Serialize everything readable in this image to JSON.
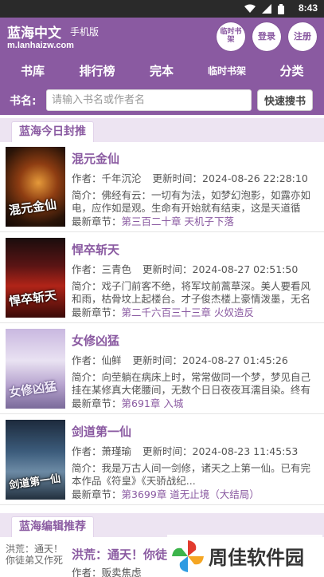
{
  "status_bar": {
    "time": "8:43",
    "icons": [
      "wifi-icon",
      "signal-icon",
      "battery-icon"
    ]
  },
  "header": {
    "site_name": "蓝海中文",
    "site_sub": "手机版",
    "site_url": "m.lanhaizw.com",
    "buttons": {
      "bookshelf": "临时书架",
      "login": "登录",
      "register": "注册"
    }
  },
  "nav": {
    "items": [
      "书库",
      "排行榜",
      "完本",
      "临时书架",
      "分类"
    ]
  },
  "search": {
    "label": "书名:",
    "placeholder": "请输入书名或作者名",
    "button": "快速搜书"
  },
  "sections": {
    "recommend": "蓝海今日封推",
    "editor": "蓝海编辑推荐"
  },
  "labels": {
    "author": "作者：",
    "updated": "更新时间：",
    "intro": "简介：",
    "latest": "最新章节："
  },
  "books": [
    {
      "title": "混元金仙",
      "author": "千年沉沦",
      "updated": "2024-08-26 22:28:10",
      "intro_1": "佛经有云：一切有为法，如梦幻泡影，如露亦如",
      "intro_2": "电，应作如是观。生命有开始就有结束，这是天道循",
      "latest": "第三百二十章 天机子下落",
      "cover_text": "混元金仙"
    },
    {
      "title": "悍卒斩天",
      "author": "三青色",
      "updated": "2024-08-27 02:51:50",
      "intro_1": "戏子门前客不绝，将军坟前蒿草深。美人要看风",
      "intro_2": "和雨，枯骨坟上起楼台。才子俊杰楼上豪情泼墨，无名",
      "latest": "第二千六百三十三章 火奴造反",
      "cover_text": "悍卒斩天"
    },
    {
      "title": "女修凶猛",
      "author": "仙鲜",
      "updated": "2024-08-27 01:45:26",
      "intro_1": "向茔躺在病床上时，常常做同一个梦，梦见自己",
      "intro_2": "挂在某修真大佬腰间，无数个日日夜夜耳濡目染。终有",
      "latest": "第691章 入城",
      "cover_text": "女修凶猛"
    },
    {
      "title": "剑道第一仙",
      "author": "萧瑾瑜",
      "updated": "2024-08-23 11:45:53",
      "intro_1": "我是万古人间一剑修，诸天之上第一仙。已有完",
      "intro_2": "本作品《符皇》《天骄战纪...",
      "latest": "第3699章 道无止境（大结局）",
      "cover_text": "剑道第一仙"
    }
  ],
  "editor_book": {
    "cover_alt": "洪荒：通天！你徒弟又作死",
    "title": "洪荒：通天！你徒",
    "author_line": "作者：贩卖焦虑"
  },
  "watermark": {
    "text": "周佳软件园"
  }
}
